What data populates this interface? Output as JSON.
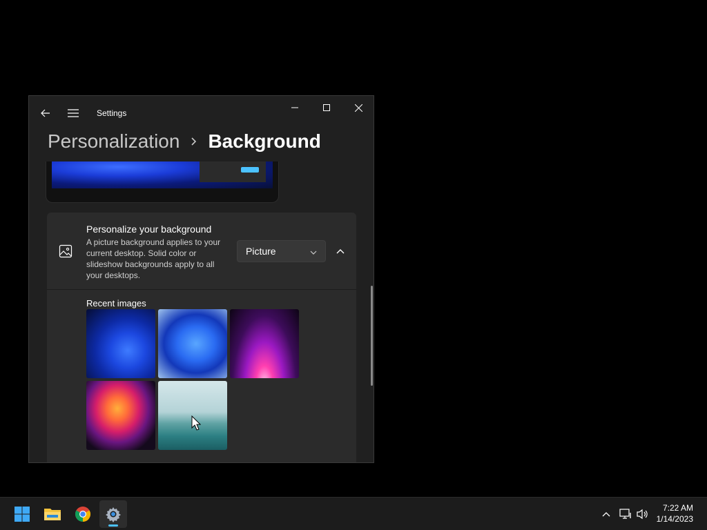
{
  "window": {
    "app_title": "Settings",
    "breadcrumb": {
      "parent": "Personalization",
      "current": "Background"
    }
  },
  "background_card": {
    "title": "Personalize your background",
    "description": "A picture background applies to your current desktop. Solid color or slideshow backgrounds apply to all your desktops.",
    "dropdown_value": "Picture"
  },
  "recent_images": {
    "label": "Recent images",
    "items": [
      {
        "name": "blue-bloom-dark"
      },
      {
        "name": "blue-bloom-light"
      },
      {
        "name": "purple-glow"
      },
      {
        "name": "colorful-ribbon"
      },
      {
        "name": "lake-landscape"
      }
    ]
  },
  "taskbar": {
    "apps": [
      "start",
      "file-explorer",
      "chrome",
      "settings"
    ],
    "clock": {
      "time": "7:22 AM",
      "date": "1/14/2023"
    }
  },
  "colors": {
    "accent": "#4cc2ff",
    "window_bg": "#202020",
    "card_bg": "#2b2b2b"
  }
}
